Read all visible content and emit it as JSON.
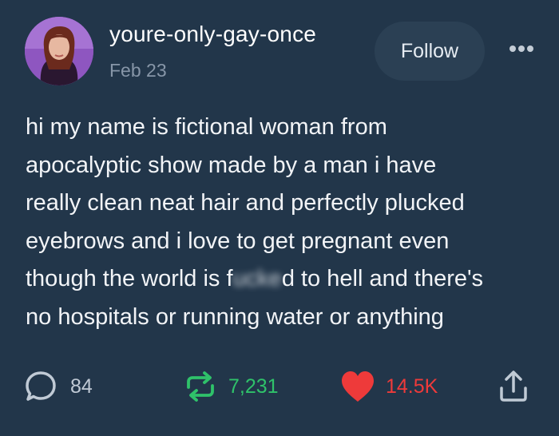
{
  "post": {
    "username": "youre-only-gay-once",
    "date": "Feb 23",
    "follow_label": "Follow",
    "more_icon": "more-dots-icon",
    "body_lines": [
      "hi my name is fictional woman from",
      "apocalyptic show made by a man i have",
      "really clean neat hair and perfectly plucked",
      "eyebrows and i love to get pregnant even"
    ],
    "line5_before": "though the world is f",
    "line5_censored": "ucke",
    "line5_after": "d to hell and there's",
    "line6": "no hospitals or running water or anything"
  },
  "actions": {
    "replies": {
      "icon": "speech-bubble-icon",
      "count": "84"
    },
    "reblogs": {
      "icon": "reblog-arrows-icon",
      "count": "7,231",
      "color": "#2fc26a"
    },
    "likes": {
      "icon": "heart-icon",
      "count": "14.5K",
      "color": "#ee3a3a"
    },
    "share": {
      "icon": "share-icon"
    }
  },
  "colors": {
    "background": "#22364a",
    "follow_button_bg": "#2b4054",
    "muted_text": "#8796a8"
  }
}
